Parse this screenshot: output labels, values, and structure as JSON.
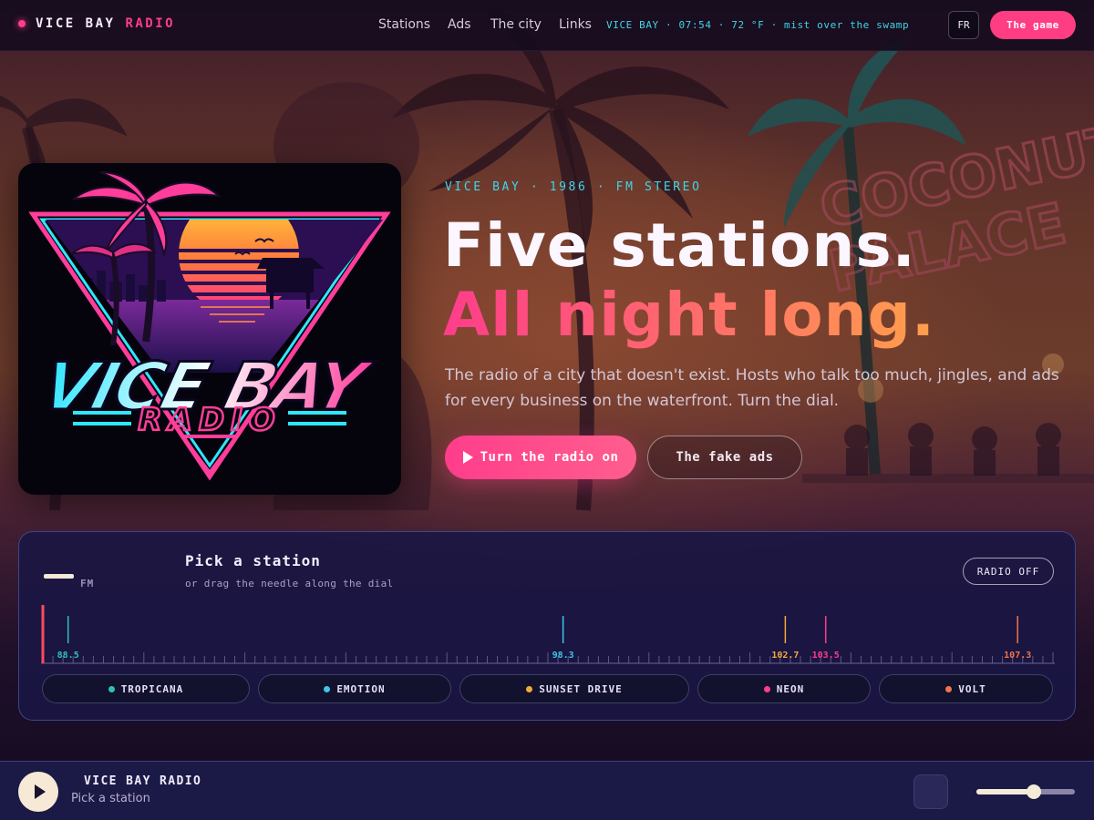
{
  "nav": {
    "brand_main": "VICE BAY",
    "brand_accent": "RADIO",
    "links": [
      "Stations",
      "Ads",
      "The city",
      "Links"
    ],
    "ticker": "VICE BAY · 07:54 · 72 °F · mist over the swamp",
    "lang": "FR",
    "cta": "The game"
  },
  "logo": {
    "icon": "vice-bay-radio-logo",
    "line1": "VICE BAY",
    "line2": "RADIO"
  },
  "hero": {
    "kicker": "VICE BAY · 1986 · FM STEREO",
    "headline1": "Five stations.",
    "headline2": "All night long.",
    "description": "The radio of a city that doesn't exist. Hosts who talk too much, jingles, and ads for every business on the waterfront. Turn the dial.",
    "primary_button": "Turn the radio on",
    "secondary_button": "The fake ads"
  },
  "tuner": {
    "frequency_unit": "FM",
    "title": "Pick a station",
    "subtitle": "or drag the needle along the dial",
    "power_button": "RADIO OFF",
    "dial_min": 88.0,
    "dial_max": 108.0,
    "needle_position": 88.0,
    "markers": [
      {
        "freq": "88.5",
        "value": 88.5,
        "color": "#2fc1b5"
      },
      {
        "freq": "98.3",
        "value": 98.3,
        "color": "#3fc6e8"
      },
      {
        "freq": "102.7",
        "value": 102.7,
        "color": "#f2a93b"
      },
      {
        "freq": "103.5",
        "value": 103.5,
        "color": "#ff3d8b"
      },
      {
        "freq": "107.3",
        "value": 107.3,
        "color": "#f0744a"
      }
    ],
    "stations": [
      {
        "name": "TROPICANA",
        "color": "#2fc1b5"
      },
      {
        "name": "EMOTION",
        "color": "#3fc6e8"
      },
      {
        "name": "SUNSET DRIVE",
        "color": "#f2a93b"
      },
      {
        "name": "NEON",
        "color": "#ff3d8b"
      },
      {
        "name": "VOLT",
        "color": "#f0744a"
      }
    ]
  },
  "player": {
    "title": "VICE BAY RADIO",
    "subtitle": "Pick a station",
    "volume": 0.58
  },
  "colors": {
    "accent_pink": "#ff3d8b",
    "accent_cyan": "#3fd6e6",
    "accent_orange": "#ffa04a"
  }
}
